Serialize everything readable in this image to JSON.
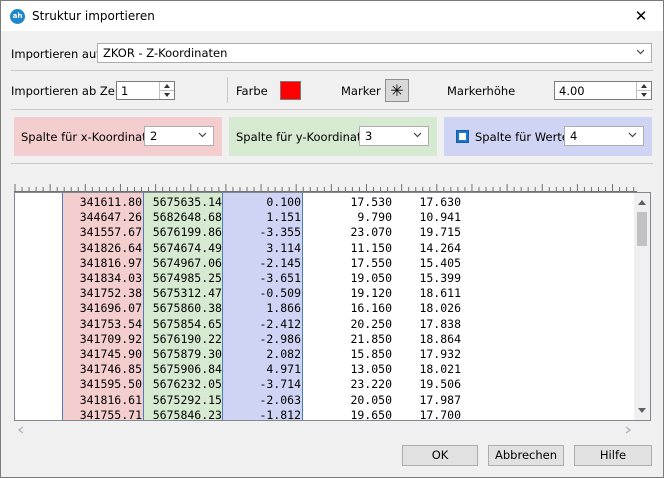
{
  "window": {
    "title": "Struktur importieren",
    "app_icon": "ah",
    "close": "✕"
  },
  "import_target": {
    "label": "Importieren auf:",
    "value": "ZKOR - Z-Koordinaten"
  },
  "options": {
    "start_row_label": "Importieren ab Zeile",
    "start_row_value": "1",
    "color_label": "Farbe",
    "color_value": "#ff0000",
    "marker_label": "Marker",
    "marker_symbol": "✳",
    "marker_height_label": "Markerhöhe",
    "marker_height_value": "4.00"
  },
  "columns": {
    "x": {
      "label": "Spalte für x-Koordinate:",
      "value": "2",
      "color": "#f4cece"
    },
    "y": {
      "label": "Spalte für y-Koordinate:",
      "value": "3",
      "color": "#d6ead1"
    },
    "w": {
      "label": "Spalte für Werte:",
      "value": "4",
      "checked": true,
      "color": "#d0d4f4"
    }
  },
  "table": {
    "rows": [
      [
        "341611.80",
        "5675635.14",
        "0.100",
        "17.530",
        "17.630"
      ],
      [
        "344647.26",
        "5682648.68",
        "1.151",
        "9.790",
        "10.941"
      ],
      [
        "341557.67",
        "5676199.86",
        "-3.355",
        "23.070",
        "19.715"
      ],
      [
        "341826.64",
        "5674674.49",
        "3.114",
        "11.150",
        "14.264"
      ],
      [
        "341816.97",
        "5674967.06",
        "-2.145",
        "17.550",
        "15.405"
      ],
      [
        "341834.03",
        "5674985.25",
        "-3.651",
        "19.050",
        "15.399"
      ],
      [
        "341752.38",
        "5675312.47",
        "-0.509",
        "19.120",
        "18.611"
      ],
      [
        "341696.07",
        "5675860.38",
        "1.866",
        "16.160",
        "18.026"
      ],
      [
        "341753.54",
        "5675854.65",
        "-2.412",
        "20.250",
        "17.838"
      ],
      [
        "341709.92",
        "5676190.22",
        "-2.986",
        "21.850",
        "18.864"
      ],
      [
        "341745.90",
        "5675879.30",
        "2.082",
        "15.850",
        "17.932"
      ],
      [
        "341746.85",
        "5675906.84",
        "4.971",
        "13.050",
        "18.021"
      ],
      [
        "341595.50",
        "5676232.05",
        "-3.714",
        "23.220",
        "19.506"
      ],
      [
        "341816.61",
        "5675292.15",
        "-2.063",
        "20.050",
        "17.987"
      ],
      [
        "341755.71",
        "5675846.23",
        "-1.812",
        "19.650",
        "17.700"
      ]
    ]
  },
  "buttons": {
    "ok": "OK",
    "cancel": "Abbrechen",
    "help": "Hilfe"
  }
}
